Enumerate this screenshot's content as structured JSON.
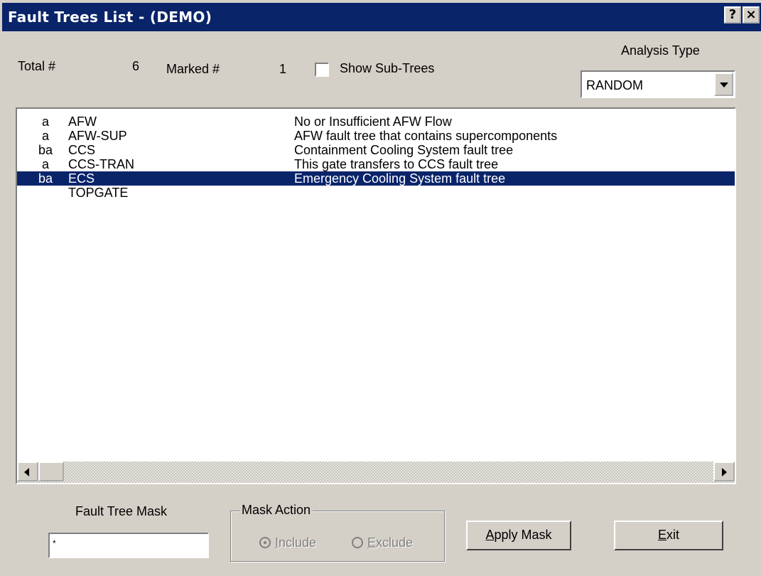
{
  "window": {
    "title": "Fault Trees List  -  (DEMO)",
    "help_label": "?",
    "close_label": "×"
  },
  "header": {
    "total_label": "Total #",
    "total_value": "6",
    "marked_label": "Marked #",
    "marked_value": "1",
    "show_subtrees_label": "Show Sub-Trees",
    "show_subtrees_checked": false,
    "analysis_type_label": "Analysis Type",
    "analysis_type_value": "RANDOM"
  },
  "list": {
    "rows": [
      {
        "flag": "a",
        "name": "AFW",
        "description": "No or Insufficient AFW Flow",
        "selected": false
      },
      {
        "flag": "a",
        "name": "AFW-SUP",
        "description": "AFW fault tree that contains supercomponents",
        "selected": false
      },
      {
        "flag": "ba",
        "name": "CCS",
        "description": "Containment Cooling System fault tree",
        "selected": false
      },
      {
        "flag": "a",
        "name": "CCS-TRAN",
        "description": "This gate transfers to CCS fault tree",
        "selected": false
      },
      {
        "flag": "ba",
        "name": "ECS",
        "description": "Emergency Cooling System fault tree",
        "selected": true
      },
      {
        "flag": "",
        "name": "TOPGATE",
        "description": "",
        "selected": false
      }
    ]
  },
  "footer": {
    "mask_label": "Fault Tree Mask",
    "mask_value": "*",
    "mask_action_label": "Mask Action",
    "include_label": "Include",
    "exclude_label": "Exclude",
    "include_selected": true,
    "apply_mask_label": "Apply Mask",
    "exit_label": "Exit"
  },
  "colors": {
    "title_bar": "#0a246a",
    "selection": "#0a246a",
    "face": "#d4d0c8"
  }
}
